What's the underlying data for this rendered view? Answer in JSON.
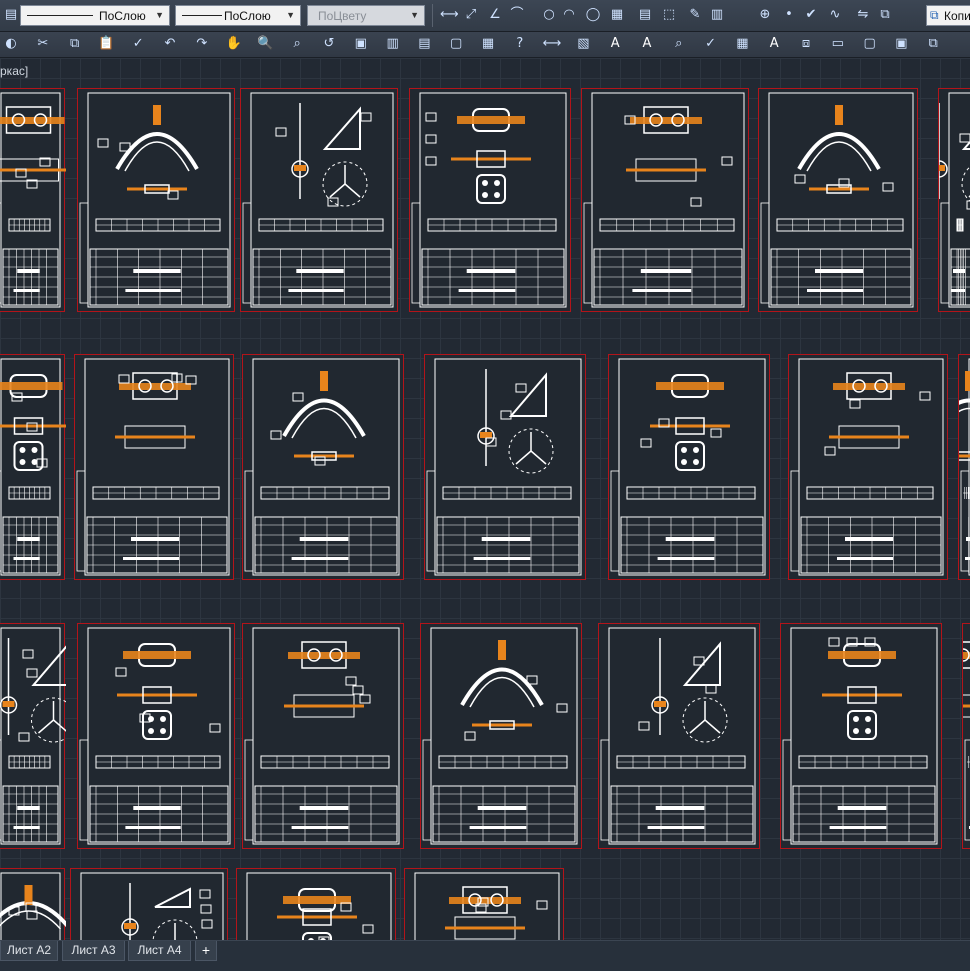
{
  "toolbar_properties": {
    "linetype": "ПоСлою",
    "lineweight": "ПоСлою",
    "plotstyle": "ПоЦвету",
    "copy_label": "Копи"
  },
  "viewport": {
    "label": "ркас]"
  },
  "layout_tabs": [
    {
      "label": "Лист А2"
    },
    {
      "label": "Лист А3"
    },
    {
      "label": "Лист А4"
    }
  ],
  "add_tab_symbol": "+",
  "icons_row1": [
    "dim-linear-icon",
    "dim-aligned-icon",
    "dim-angular-icon",
    "dim-arc-icon",
    "circle-icon",
    "arc-icon",
    "ellipse-icon",
    "hatch-icon",
    "table-icon",
    "block-icon",
    "attribute-icon",
    "grid-icon",
    "insert-icon",
    "point-icon",
    "check-icon",
    "spline-icon",
    "mirror-icon",
    "copy-icon"
  ],
  "icons_row2": [
    "save-icon",
    "cut-icon",
    "copy-icon",
    "paste-icon",
    "match-properties-icon",
    "undo-icon",
    "redo-icon",
    "pan-icon",
    "zoom-icon",
    "zoom-window-icon",
    "zoom-previous-icon",
    "properties-icon",
    "design-center-icon",
    "tool-palettes-icon",
    "sheet-set-icon",
    "calculator-icon",
    "help-icon",
    "measure-icon",
    "layer-icon",
    "text-icon",
    "mtext-icon",
    "find-icon",
    "spell-icon",
    "table-style-icon",
    "text-style-icon",
    "block-icon",
    "layout-icon",
    "viewport-icon",
    "multiview-icon",
    "publish-icon"
  ],
  "colors": {
    "sheet_border": "#b3141a",
    "drawing_line": "#ffffff",
    "accent_parts": "#e8841c",
    "background": "#212830"
  }
}
